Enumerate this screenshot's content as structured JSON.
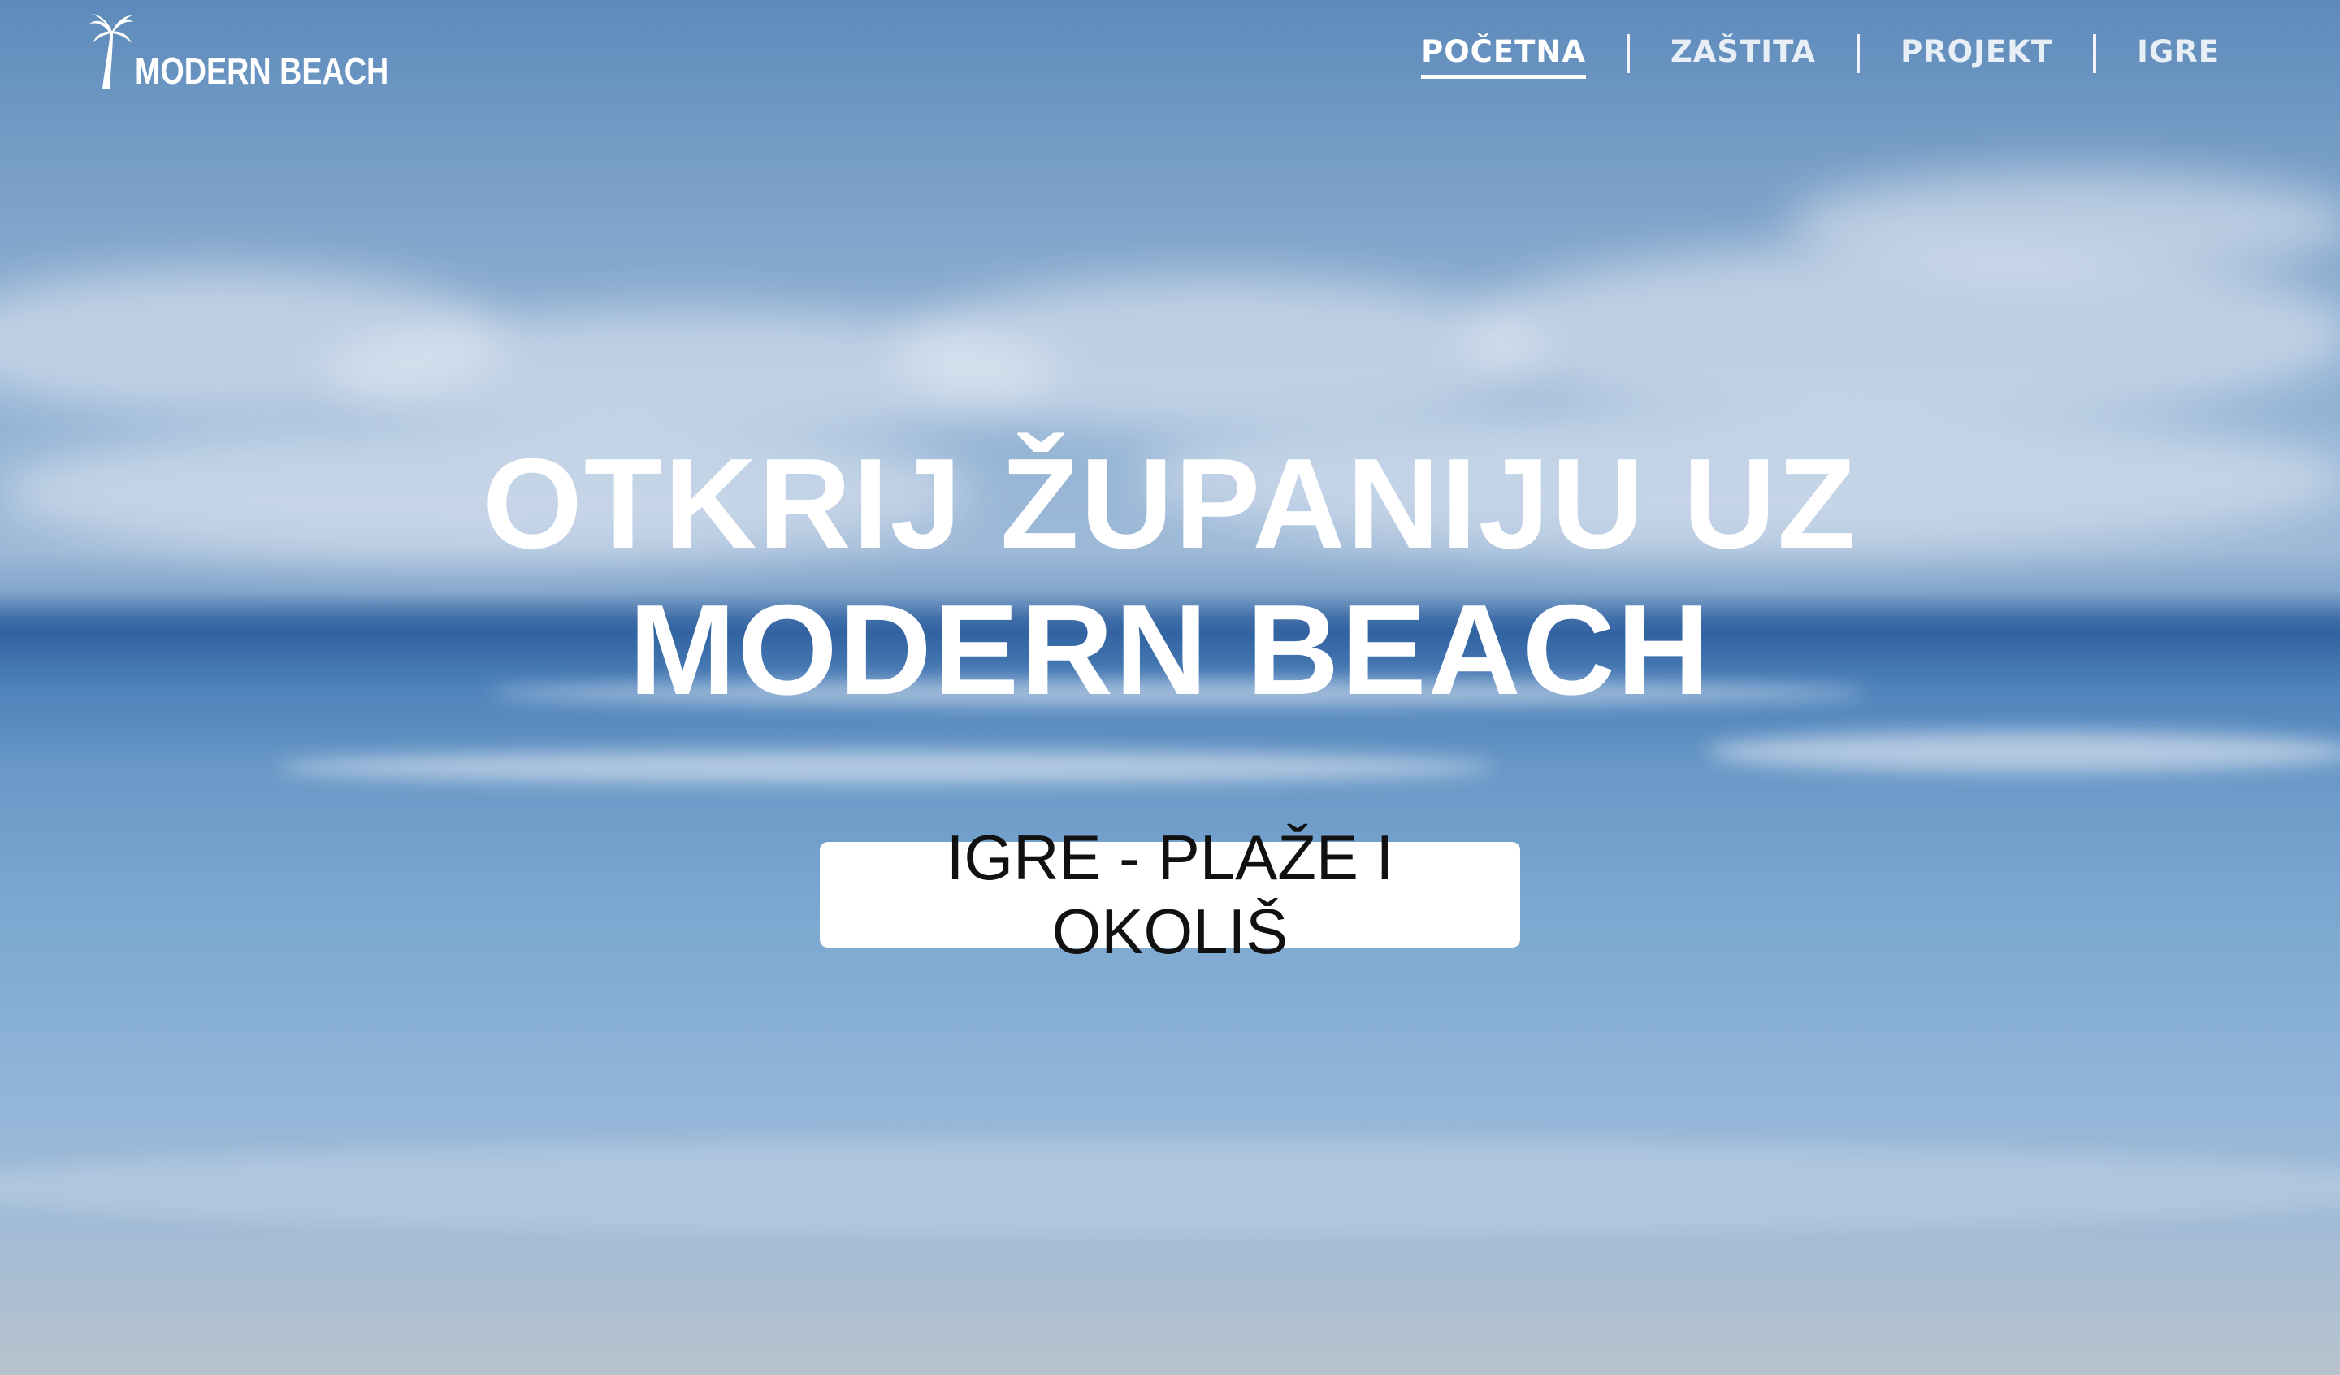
{
  "brand": {
    "logo_text": "MODERN BEACH",
    "logo_icon": "palm-tree-icon"
  },
  "nav": {
    "items": [
      {
        "label": "POČETNA",
        "active": true
      },
      {
        "label": "ZAŠTITA",
        "active": false
      },
      {
        "label": "PROJEKT",
        "active": false
      },
      {
        "label": "IGRE",
        "active": false
      }
    ]
  },
  "hero": {
    "headline_line1": "OTKRIJ ŽUPANIJU UZ",
    "headline_line2": "MODERN BEACH",
    "cta_label": "IGRE - PLAŽE I OKOLIŠ"
  },
  "colors": {
    "text": "#ffffff",
    "cta_background": "#ffffff",
    "cta_text": "#111111",
    "sky": "#8fb2d3",
    "sea": "#2f62a0"
  }
}
